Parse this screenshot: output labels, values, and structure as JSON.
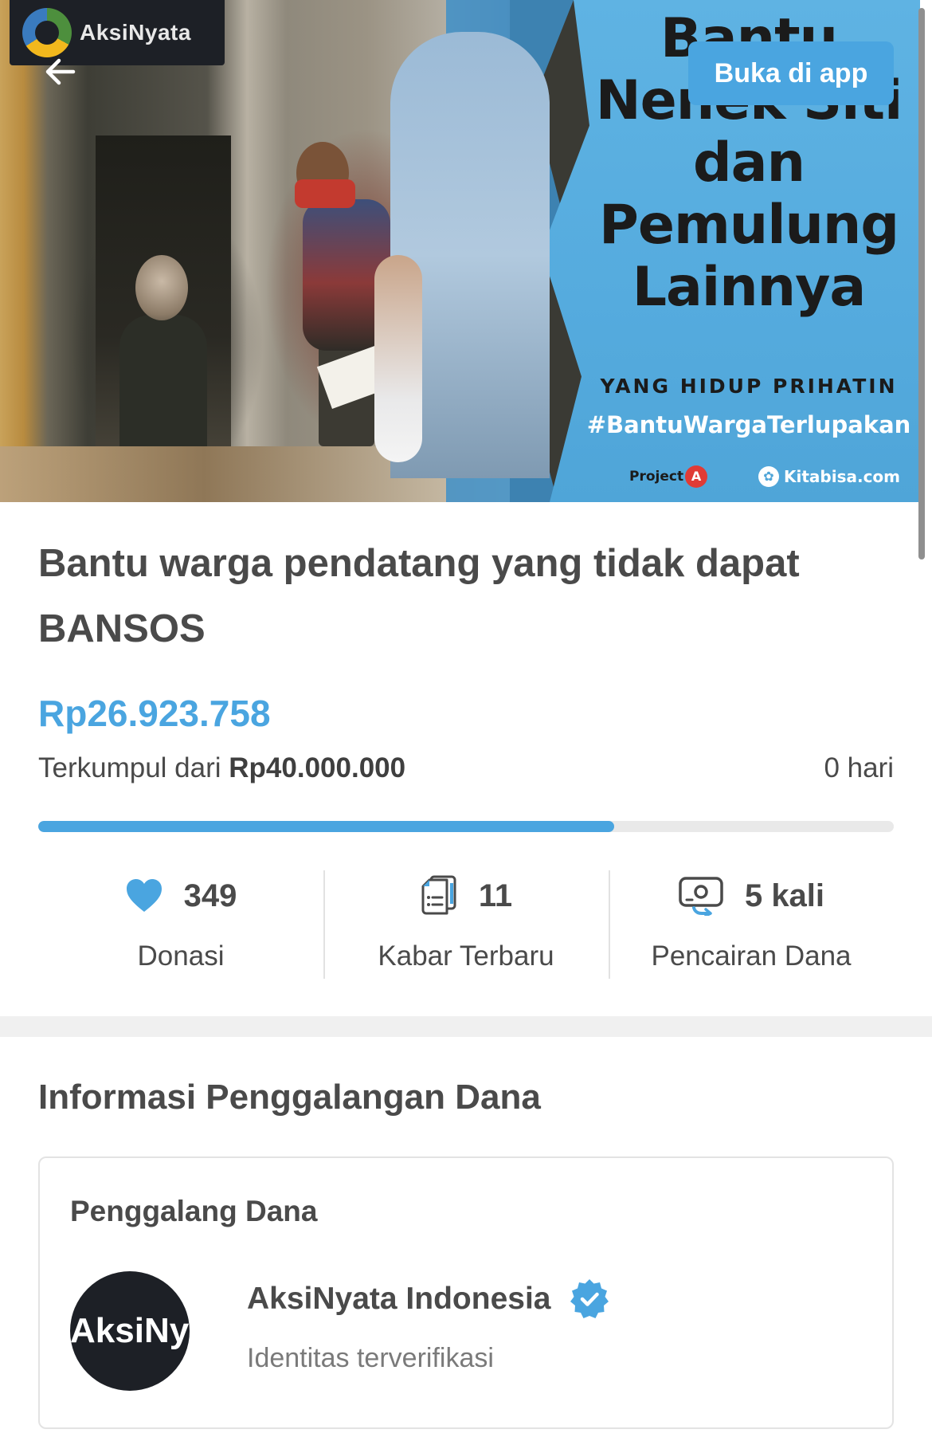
{
  "hero": {
    "brand_badge": "AksiNyata",
    "open_app_label": "Buka di app",
    "banner_title_lines": [
      "Bantu",
      "Nenek Siti",
      "dan",
      "Pemulung",
      "Lainnya"
    ],
    "banner_subtitle": "YANG HIDUP PRIHATIN",
    "banner_hashtag": "#BantuWargaTerlupakan",
    "banner_logo_left": "Project",
    "banner_logo_left_mark": "A",
    "banner_logo_right": "Kitabisa.com",
    "back_icon": "arrow-left-icon"
  },
  "campaign": {
    "title": "Bantu warga pendatang yang tidak dapat BANSOS",
    "collected": "Rp26.923.758",
    "target_prefix": "Terkumpul dari",
    "target_amount": "Rp40.000.000",
    "days_left": "0 hari",
    "progress_fraction": 0.673,
    "accent_color": "#4aa5e0"
  },
  "stats": [
    {
      "icon": "heart-icon",
      "value": "349",
      "label": "Donasi"
    },
    {
      "icon": "news-updates-icon",
      "value": "11",
      "label": "Kabar Terbaru"
    },
    {
      "icon": "fund-disbursement-icon",
      "value": "5 kali",
      "label": "Pencairan Dana"
    }
  ],
  "info_section": {
    "title": "Informasi Penggalangan Dana",
    "card_label": "Penggalang Dana",
    "org_avatar_text": "AksiNy",
    "org_name": "AksiNyata Indonesia",
    "org_status": "Identitas terverifikasi",
    "verified_icon": "verified-badge-icon"
  }
}
